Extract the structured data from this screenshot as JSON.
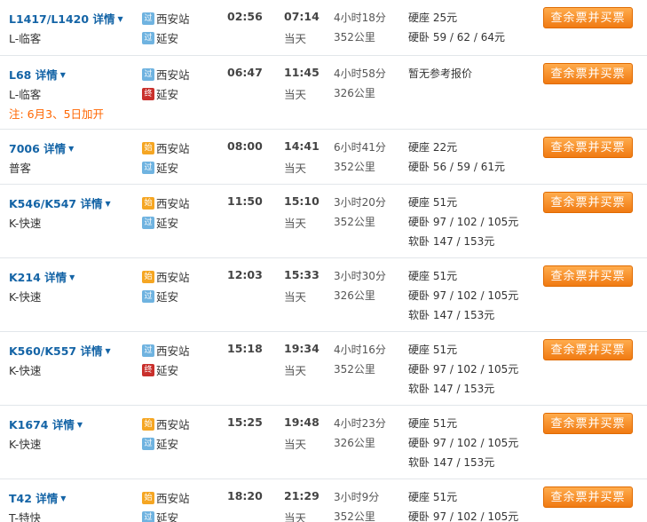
{
  "buy_label": "查余票并买票",
  "detail_label": "详情",
  "rows": [
    {
      "train": "L1417/L1420",
      "type": "L-临客",
      "note": "",
      "from_badge": "过",
      "from": "西安站",
      "to_badge": "过",
      "to": "延安",
      "depart": "02:56",
      "arrive": "07:14",
      "day": "当天",
      "duration": "4小时18分",
      "distance": "352公里",
      "prices": [
        "硬座 25元",
        "硬卧 59 / 62 / 64元"
      ]
    },
    {
      "train": "L68",
      "type": "L-临客",
      "note": "注: 6月3、5日加开",
      "from_badge": "过",
      "from": "西安站",
      "to_badge": "终",
      "to": "延安",
      "depart": "06:47",
      "arrive": "11:45",
      "day": "当天",
      "duration": "4小时58分",
      "distance": "326公里",
      "prices": [
        "暂无参考报价"
      ]
    },
    {
      "train": "7006",
      "type": "普客",
      "note": "",
      "from_badge": "始",
      "from": "西安站",
      "to_badge": "过",
      "to": "延安",
      "depart": "08:00",
      "arrive": "14:41",
      "day": "当天",
      "duration": "6小时41分",
      "distance": "352公里",
      "prices": [
        "硬座 22元",
        "硬卧 56 / 59 / 61元"
      ]
    },
    {
      "train": "K546/K547",
      "type": "K-快速",
      "note": "",
      "from_badge": "始",
      "from": "西安站",
      "to_badge": "过",
      "to": "延安",
      "depart": "11:50",
      "arrive": "15:10",
      "day": "当天",
      "duration": "3小时20分",
      "distance": "352公里",
      "prices": [
        "硬座 51元",
        "硬卧 97 / 102 / 105元",
        "软卧 147 / 153元"
      ]
    },
    {
      "train": "K214",
      "type": "K-快速",
      "note": "",
      "from_badge": "始",
      "from": "西安站",
      "to_badge": "过",
      "to": "延安",
      "depart": "12:03",
      "arrive": "15:33",
      "day": "当天",
      "duration": "3小时30分",
      "distance": "326公里",
      "prices": [
        "硬座 51元",
        "硬卧 97 / 102 / 105元",
        "软卧 147 / 153元"
      ]
    },
    {
      "train": "K560/K557",
      "type": "K-快速",
      "note": "",
      "from_badge": "过",
      "from": "西安站",
      "to_badge": "终",
      "to": "延安",
      "depart": "15:18",
      "arrive": "19:34",
      "day": "当天",
      "duration": "4小时16分",
      "distance": "352公里",
      "prices": [
        "硬座 51元",
        "硬卧 97 / 102 / 105元",
        "软卧 147 / 153元"
      ]
    },
    {
      "train": "K1674",
      "type": "K-快速",
      "note": "",
      "from_badge": "始",
      "from": "西安站",
      "to_badge": "过",
      "to": "延安",
      "depart": "15:25",
      "arrive": "19:48",
      "day": "当天",
      "duration": "4小时23分",
      "distance": "326公里",
      "prices": [
        "硬座 51元",
        "硬卧 97 / 102 / 105元",
        "软卧 147 / 153元"
      ]
    },
    {
      "train": "T42",
      "type": "T-特快",
      "note": "",
      "from_badge": "始",
      "from": "西安站",
      "to_badge": "过",
      "to": "延安",
      "depart": "18:20",
      "arrive": "21:29",
      "day": "当天",
      "duration": "3小时9分",
      "distance": "352公里",
      "prices": [
        "硬座 51元",
        "硬卧 97 / 102 / 105元"
      ]
    }
  ]
}
